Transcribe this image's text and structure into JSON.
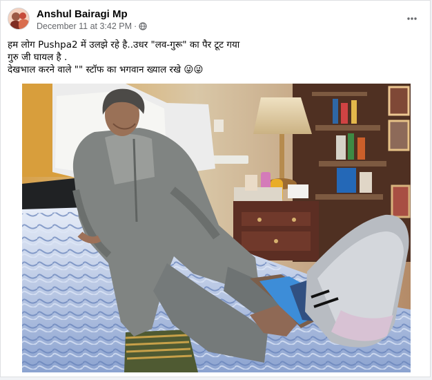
{
  "post": {
    "author": "Anshul Bairagi Mp",
    "date": "December 11 at 3:42 PM",
    "separator": "·",
    "more_symbol": "•••",
    "lines": [
      "हम लोग Pushpa2  में उलझे रहे है..उधर \"लव-गुरू\" का पैर टूट गया",
      "गुरु जी घायल है .",
      "देखभाल करने वाले \"\" स्टॉफ का भगवान ख्याल रखे 😜😜"
    ]
  },
  "icons": {
    "visibility": "globe-icon",
    "menu": "more-options-icon",
    "avatar": "profile-avatar"
  },
  "colors": {
    "name": "#050505",
    "meta": "#65676b",
    "border": "#dddfe2"
  }
}
